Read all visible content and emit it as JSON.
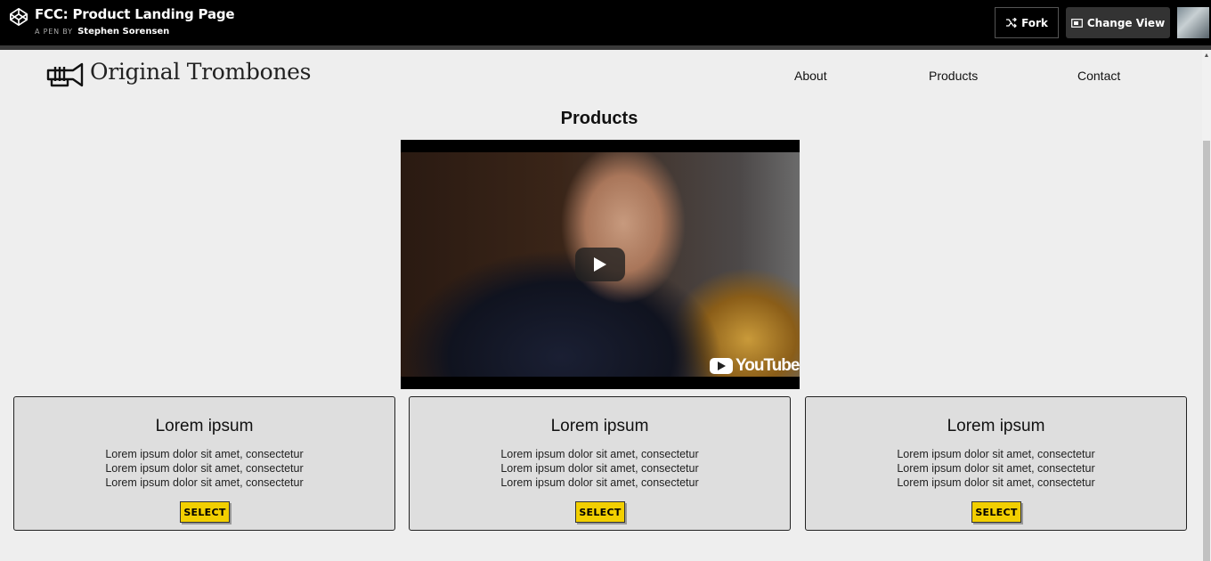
{
  "codepen": {
    "pen_title": "FCC: Product Landing Page",
    "by_label": "A PEN BY",
    "author": "Stephen Sorensen",
    "fork_label": "Fork",
    "change_view_label": "Change View"
  },
  "site": {
    "name": "Original Trombones",
    "nav": [
      {
        "label": "About"
      },
      {
        "label": "Products"
      },
      {
        "label": "Contact"
      }
    ]
  },
  "products_section": {
    "title": "Products",
    "video": {
      "brand": "YouTube"
    }
  },
  "cards": [
    {
      "title": "Lorem ipsum",
      "lines": [
        "Lorem ipsum dolor sit amet, consectetur",
        "Lorem ipsum dolor sit amet, consectetur",
        "Lorem ipsum dolor sit amet, consectetur"
      ],
      "button": "SELECT"
    },
    {
      "title": "Lorem ipsum",
      "lines": [
        "Lorem ipsum dolor sit amet, consectetur",
        "Lorem ipsum dolor sit amet, consectetur",
        "Lorem ipsum dolor sit amet, consectetur"
      ],
      "button": "SELECT"
    },
    {
      "title": "Lorem ipsum",
      "lines": [
        "Lorem ipsum dolor sit amet, consectetur",
        "Lorem ipsum dolor sit amet, consectetur",
        "Lorem ipsum dolor sit amet, consectetur"
      ],
      "button": "SELECT"
    }
  ],
  "colors": {
    "select_button": "#f2cf00",
    "page_background": "#eeeeee",
    "card_background": "#dedede"
  },
  "icons": [
    "codepen-logo-icon",
    "fork-icon",
    "change-view-icon",
    "trumpet-logo-icon",
    "play-icon",
    "youtube-icon"
  ]
}
